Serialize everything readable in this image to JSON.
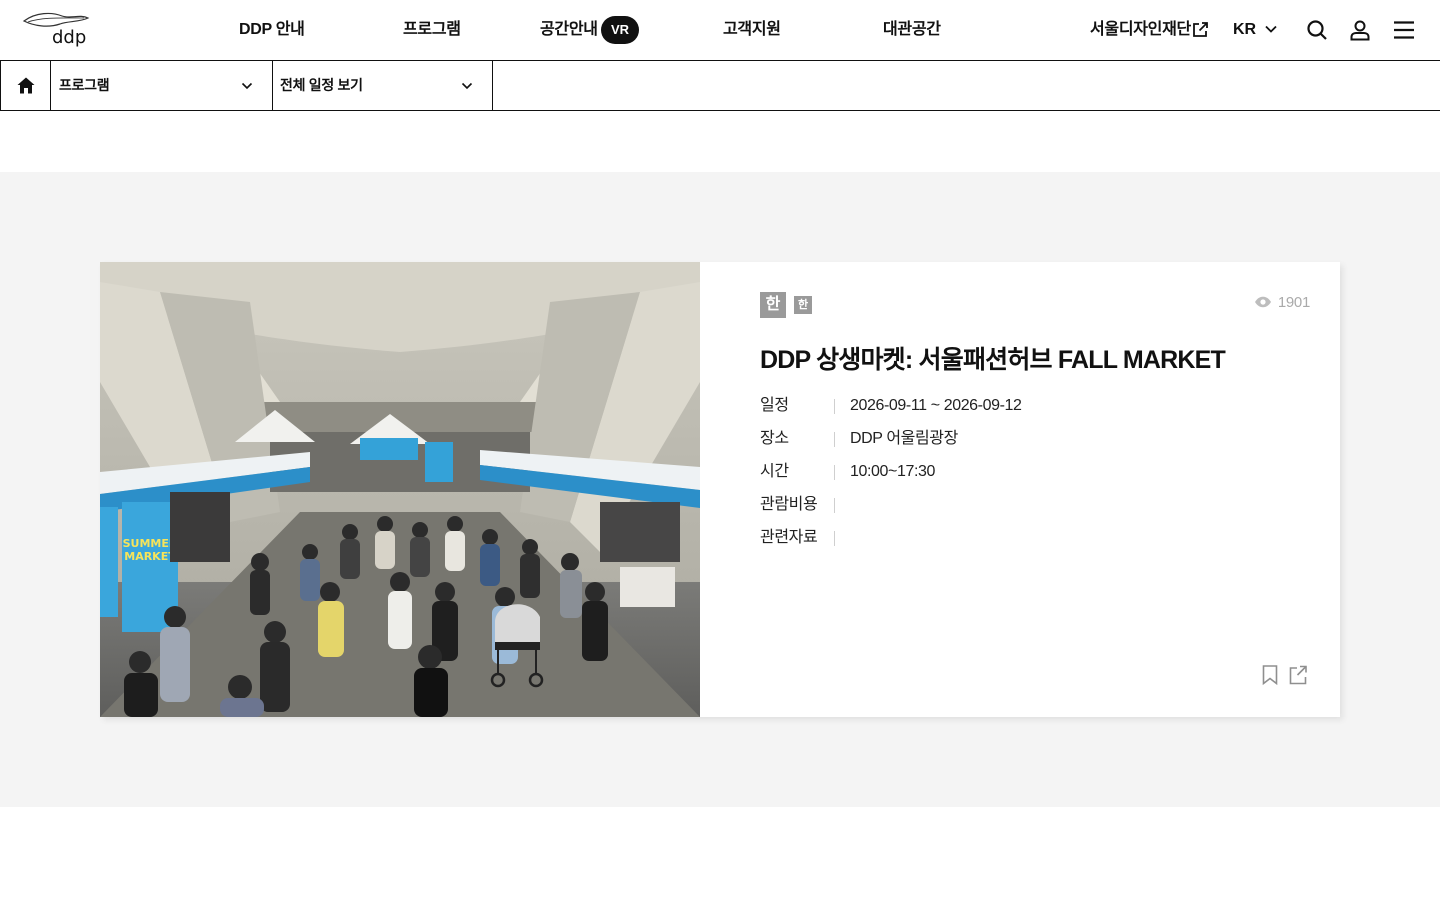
{
  "header": {
    "logo_text": "ddp",
    "nav": [
      "DDP 안내",
      "프로그램",
      "공간안내",
      "고객지원",
      "대관공간"
    ],
    "vr_badge": "VR",
    "foundation_link": "서울디자인재단",
    "language": "KR",
    "icons": [
      "search-icon",
      "user-icon",
      "menu-icon"
    ]
  },
  "filters": {
    "home_icon": "home-icon",
    "category": "프로그램",
    "schedule": "전체 일정 보기"
  },
  "event": {
    "lang_tags": [
      "한",
      "한"
    ],
    "views": "1901",
    "title": "DDP 상생마켓: 서울패션허브 FALL MARKET",
    "details": [
      {
        "label": "일정",
        "value": "2026-09-11 ~ 2026-09-12"
      },
      {
        "label": "장소",
        "value": "DDP 어울림광장"
      },
      {
        "label": "시간",
        "value": "10:00~17:30"
      },
      {
        "label": "관람비용",
        "value": ""
      },
      {
        "label": "관련자료",
        "value": ""
      }
    ],
    "photo_banner_text": "SUMMER MARKET",
    "actions": [
      "bookmark-icon",
      "share-icon"
    ]
  },
  "colors": {
    "band_bg": "#f4f4f4",
    "tag_gray": "#9a9a9a",
    "text": "#111111",
    "muted": "#aaaaaa"
  }
}
